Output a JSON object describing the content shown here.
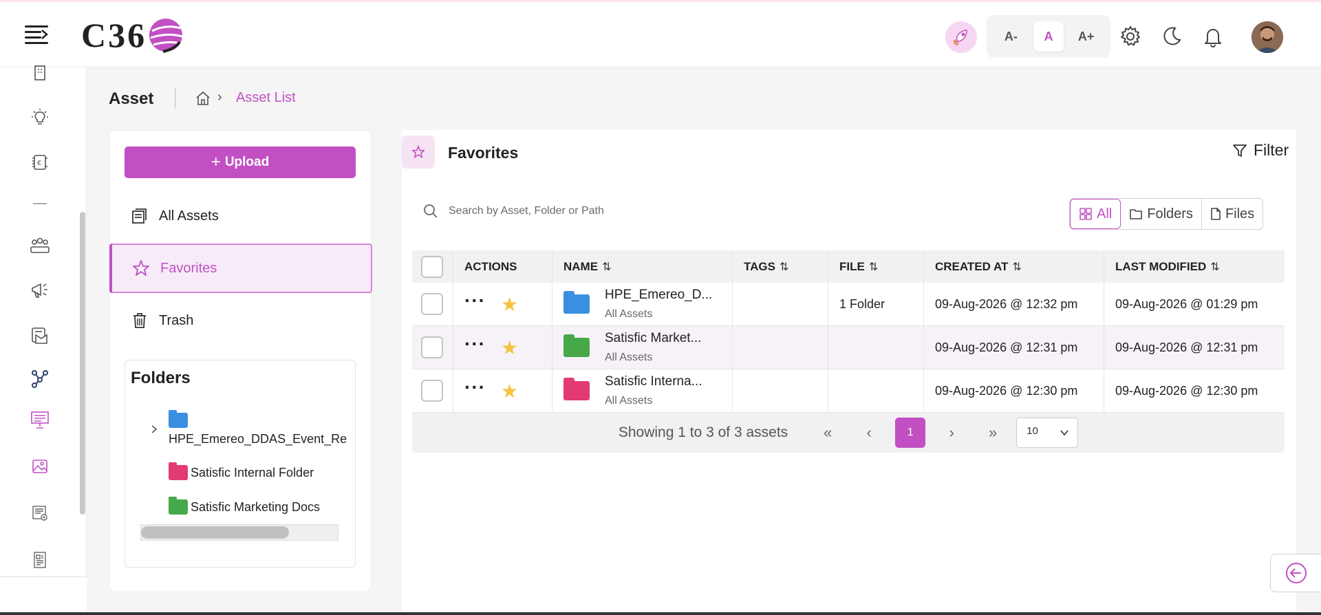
{
  "header": {
    "logo_text": "C36",
    "font_small": "A-",
    "font_normal": "A",
    "font_large": "A+"
  },
  "breadcrumb": {
    "page_title": "Asset",
    "current": "Asset List"
  },
  "left_panel": {
    "upload_label": "Upload",
    "nav": [
      {
        "label": "All Assets"
      },
      {
        "label": "Favorites"
      },
      {
        "label": "Trash"
      }
    ],
    "folders_title": "Folders",
    "folders": [
      {
        "label": "HPE_Emereo_DDAS_Event_Re",
        "color": "#3b8fe0"
      },
      {
        "label": "Satisfic Internal Folder",
        "color": "#e23a74"
      },
      {
        "label": "Satisfic Marketing Docs",
        "color": "#47a84a"
      }
    ]
  },
  "main": {
    "title": "Favorites",
    "filter_label": "Filter",
    "search_placeholder": "Search by Asset, Folder or Path",
    "view_tabs": [
      {
        "label": "All",
        "active": true
      },
      {
        "label": "Folders",
        "active": false
      },
      {
        "label": "Files",
        "active": false
      }
    ],
    "columns": [
      "ACTIONS",
      "NAME",
      "TAGS",
      "FILE",
      "CREATED AT",
      "LAST MODIFIED"
    ],
    "rows": [
      {
        "name": "HPE_Emereo_D...",
        "location": "All Assets",
        "tags": "",
        "file": "1 Folder",
        "created": "09-Aug-2026 @ 12:32 pm",
        "modified": "09-Aug-2026 @ 01:29 pm",
        "folder_color": "#3b8fe0"
      },
      {
        "name": "Satisfic Market...",
        "location": "All Assets",
        "tags": "",
        "file": "",
        "created": "09-Aug-2026 @ 12:31 pm",
        "modified": "09-Aug-2026 @ 12:31 pm",
        "folder_color": "#47a84a"
      },
      {
        "name": "Satisfic Interna...",
        "location": "All Assets",
        "tags": "",
        "file": "",
        "created": "09-Aug-2026 @ 12:30 pm",
        "modified": "09-Aug-2026 @ 12:30 pm",
        "folder_color": "#e23a74"
      }
    ],
    "pager": {
      "summary": "Showing 1 to 3 of 3 assets",
      "current_page": "1",
      "page_size": "10"
    }
  },
  "colors": {
    "accent": "#c250c3",
    "star": "#f5c242"
  }
}
